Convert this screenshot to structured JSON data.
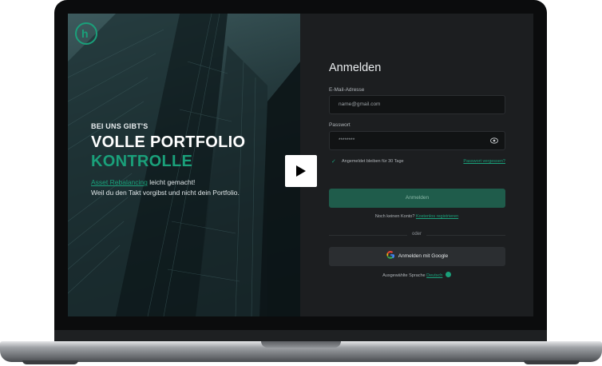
{
  "hero": {
    "kicker": "BEI UNS GIBT'S",
    "headline_line1": "VOLLE PORTFOLIO",
    "headline_line2": "KONTROLLE",
    "sub_link": "Asset Rebalancing",
    "sub_rest": " leicht gemacht!",
    "sub_line2": "Weil du den Takt vorgibst und nicht dein Portfolio."
  },
  "login": {
    "title": "Anmelden",
    "email_label": "E-Mail-Adresse",
    "email_placeholder": "name@gmail.com",
    "password_label": "Passwort",
    "password_value": "********",
    "remember_label": "Angemeldet bleiben für 30 Tage",
    "forgot_link": "Passwort vergessen?",
    "submit_label": "Anmelden",
    "no_account_text": "Noch keinen Konto?",
    "register_link": "Kostenlos registrieren",
    "divider_text": "oder",
    "google_button": "Anmelden mit Google",
    "language_text": "Ausgewählte Sprache",
    "language_link": "Deutsch"
  },
  "icons": {
    "logo": "logo-icon",
    "eye": "eye-icon",
    "google": "google-icon",
    "globe": "globe-icon",
    "play": "play-icon",
    "check": "check-icon"
  },
  "colors": {
    "accent": "#1aa07a",
    "panel": "#1c1e20",
    "input_bg": "#111314",
    "primary_button": "#1f5c4b",
    "google_button": "#2b2e31"
  }
}
